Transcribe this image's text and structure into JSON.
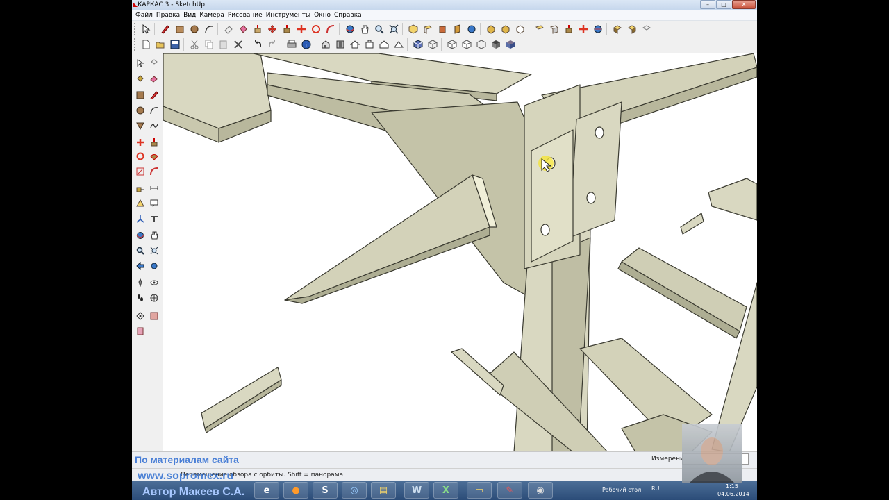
{
  "window": {
    "title": "КАРКАС 3 - SketchUp"
  },
  "menu": {
    "items": [
      "Файл",
      "Правка",
      "Вид",
      "Камера",
      "Рисование",
      "Инструменты",
      "Окно",
      "Справка"
    ]
  },
  "status": {
    "hint": "Перемещение обзора с орбиты.  Shift = панорама",
    "measure_label": "Измерения",
    "measure_value": ""
  },
  "taskbar": {
    "desktop_label": "Рабочий стол",
    "lang": "RU",
    "time": "1:15",
    "date": "04.06.2014"
  },
  "watermark": {
    "line1": "По материалам сайта",
    "line2": "www.sopromex.ru",
    "line3": "Автор Макеев С.А."
  },
  "icons": {
    "toolbar_row1": [
      "select-icon",
      "pencil-icon",
      "rectangle-icon",
      "circle-icon",
      "arc-icon",
      "eraser-icon",
      "paint-bucket-icon",
      "push-pull-icon",
      "move-icon",
      "rotate-icon",
      "follow-me-icon",
      "orbit-icon",
      "pan-icon",
      "zoom-icon",
      "zoom-extents-icon",
      "iso-view-icon",
      "top-view-icon",
      "front-view-icon",
      "right-view-icon",
      "back-view-icon",
      "left-view-icon",
      "xray-icon",
      "wireframe-icon",
      "shaded-icon",
      "textured-icon",
      "monochrome-icon"
    ],
    "toolbar_row2": [
      "new-icon",
      "open-icon",
      "save-icon",
      "cut-icon",
      "copy-icon",
      "paste-icon",
      "delete-icon",
      "undo-icon",
      "redo-icon",
      "print-icon",
      "model-info-icon",
      "iso-icon",
      "top-icon",
      "front-icon",
      "right-icon",
      "back-icon",
      "left-icon",
      "xray-style-icon",
      "hidden-line-icon",
      "shaded-style-icon",
      "textured-style-icon",
      "mono-style-icon"
    ]
  },
  "colors": {
    "steel_face": "#d9d8c1",
    "steel_shade": "#b8b79c",
    "steel_edge": "#3a3a30",
    "accent_blue": "#2f6fd0",
    "viewport_bg": "#ffffff"
  }
}
